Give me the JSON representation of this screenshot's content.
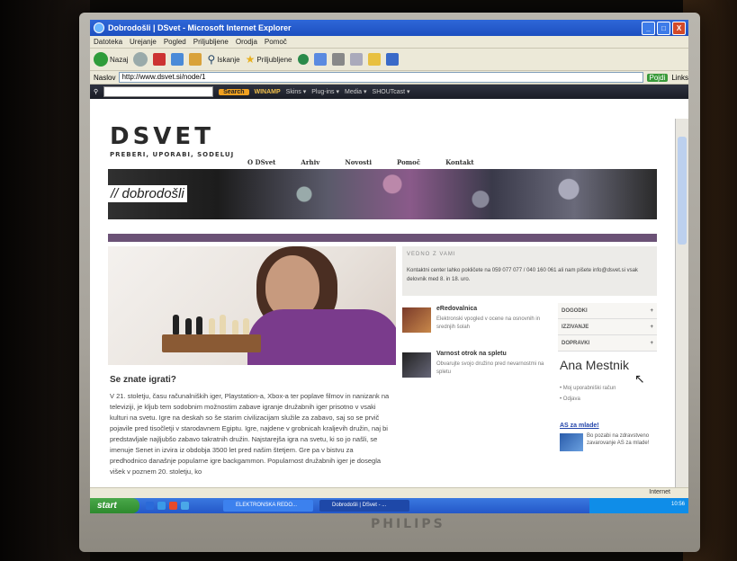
{
  "window": {
    "title": "Dobrodošli | DSvet - Microsoft Internet Explorer",
    "controls": [
      "_",
      "□",
      "X"
    ]
  },
  "menubar": [
    "Datoteka",
    "Urejanje",
    "Pogled",
    "Priljubljene",
    "Orodja",
    "Pomoč"
  ],
  "toolbar": {
    "back": "Nazaj",
    "search": "Iskanje",
    "favorites": "Priljubljene"
  },
  "address": {
    "label": "Naslov",
    "url": "http://www.dsvet.si/node/1",
    "go": "Pojdi",
    "links": "Links"
  },
  "searchbar": {
    "search_button": "Search",
    "winamp": "WINAMP",
    "items": [
      "Skins ▾",
      "Plug-ins ▾",
      "Media ▾",
      "SHOUTcast ▾"
    ]
  },
  "site": {
    "logo": "DSVET",
    "tagline": "PREBERI, UPORABI, SODELUJ",
    "nav": [
      "O DSvet",
      "Arhiv",
      "Novosti",
      "Pomoč",
      "Kontakt"
    ],
    "banner_title": "// dobrodošli",
    "article": {
      "title": "Se znate igrati?",
      "body": "V 21. stoletju, času računalniških iger, Playstation-a, Xbox-a ter poplave filmov in nanizank na televiziji, je kljub tem sodobnim možnostim zabave igranje družabnih iger prisotno v vsaki kulturi na svetu. Igre na deskah so še starim civilizacijam služile za zabavo, saj so se prvič pojavile pred tisočletji v starodavnem Egiptu. Igre, najdene v grobnicah kraljevih družin, naj bi predstavljale najljubšo zabavo takratnih družin. Najstarejša igra na svetu, ki so jo našli, se imenuje Senet in izvira iz obdobja 3500 let pred našim štetjem. Gre pa v bistvu za predhodnico današnje popularne igre backgammon. Popularnost družabnih iger je dosegla višek v poznem 20. stoletju, ko"
    },
    "notice": {
      "title": "VEDNO Z VAMI",
      "text": "Kontaktni center lahko pokličete na 059 077 077 / 040 160 061 ali nam pišete info@dsvet.si vsak delovnik med 8. in 18. uro."
    },
    "news": [
      {
        "title": "eRedovalnica",
        "desc": "Elektronski vpogled v ocene na osnovnih in srednjih šolah"
      },
      {
        "title": "Varnost otrok na spletu",
        "desc": "Obvarujte svojo družino pred nevarnostmi na spletu"
      }
    ],
    "sidemenu": [
      "DOGODKI",
      "IZZIVANJE",
      "DOPRAVKI"
    ],
    "user": {
      "name": "Ana Mestnik",
      "links": [
        "Moj uporabniški račun",
        "Odjava"
      ]
    },
    "promo": {
      "title": "AS za mlade!",
      "text": "Bo pozabi na zdravstveno zavarovanje AS za mlade!"
    }
  },
  "statusbar": {
    "zone": "Internet"
  },
  "taskbar": {
    "start": "start",
    "tasks": [
      "ELEKTRONSKA REDO...",
      "Dobrodošli | DSvet - ..."
    ],
    "clock": "10:56"
  },
  "monitor": {
    "brand": "PHILIPS"
  }
}
